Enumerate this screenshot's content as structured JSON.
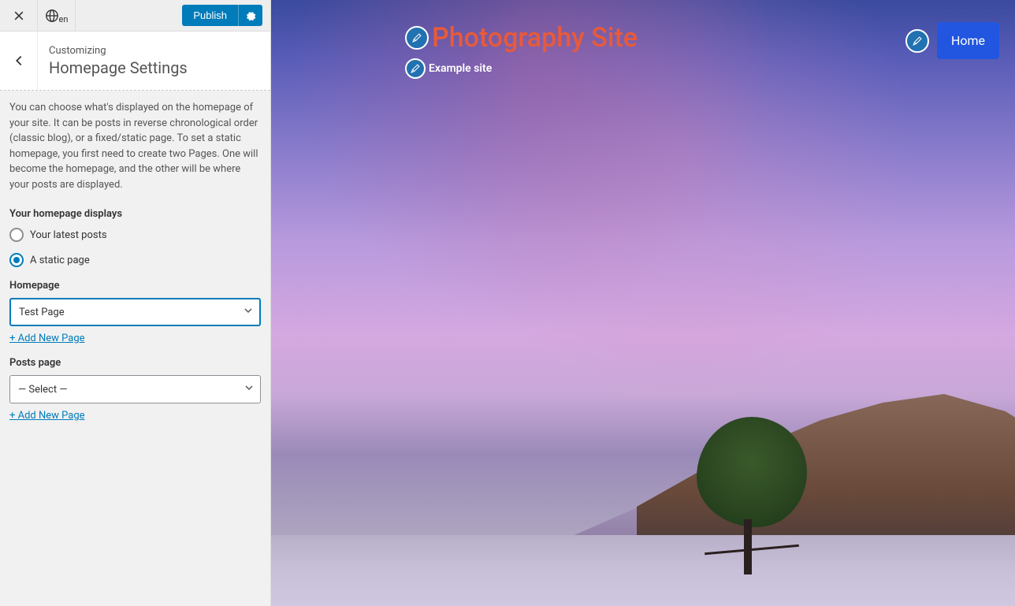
{
  "topbar": {
    "lang_code": "en",
    "publish_label": "Publish"
  },
  "header": {
    "breadcrumb": "Customizing",
    "title": "Homepage Settings"
  },
  "panel": {
    "description": "You can choose what's displayed on the homepage of your site. It can be posts in reverse chronological order (classic blog), or a fixed/static page. To set a static homepage, you first need to create two Pages. One will become the homepage, and the other will be where your posts are displayed.",
    "displays_label": "Your homepage displays",
    "radio_latest": "Your latest posts",
    "radio_static": "A static page",
    "homepage_label": "Homepage",
    "homepage_value": "Test Page",
    "add_new_page": "+ Add New Page",
    "posts_page_label": "Posts page",
    "posts_page_value": "— Select —"
  },
  "preview": {
    "site_title": "Photography Site",
    "tagline": "Example site",
    "nav_home": "Home"
  }
}
